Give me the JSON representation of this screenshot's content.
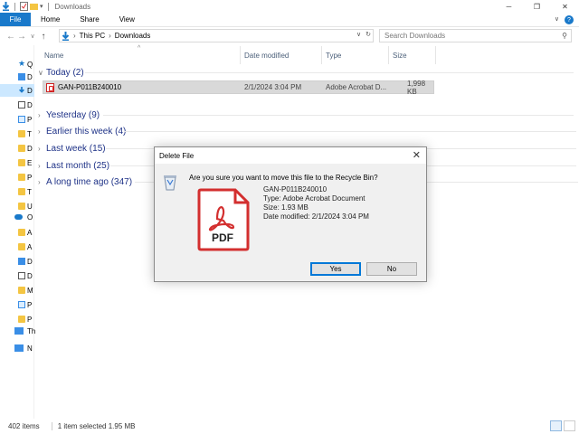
{
  "window": {
    "title": "Downloads",
    "controls": [
      "minimize-icon",
      "maximize-icon",
      "close-icon"
    ]
  },
  "ribbon": {
    "tabs": [
      "File",
      "Home",
      "Share",
      "View"
    ]
  },
  "address": {
    "path": [
      "This PC",
      "Downloads"
    ],
    "search_placeholder": "Search Downloads"
  },
  "nav_pane": {
    "items": [
      {
        "label": "Q",
        "icon": "star-icon"
      },
      {
        "label": "D",
        "icon": "desktop-icon"
      },
      {
        "label": "D",
        "icon": "download-icon"
      },
      {
        "label": "D",
        "icon": "document-icon"
      },
      {
        "label": "P",
        "icon": "pictures-icon"
      },
      {
        "label": "T",
        "icon": "folder-icon"
      },
      {
        "label": "D",
        "icon": "folder-icon"
      },
      {
        "label": "E",
        "icon": "folder-icon"
      },
      {
        "label": "P",
        "icon": "folder-icon"
      },
      {
        "label": "T",
        "icon": "folder-icon"
      },
      {
        "label": "U",
        "icon": "folder-icon"
      },
      {
        "label": "O",
        "icon": "cloud-icon"
      },
      {
        "label": "A",
        "icon": "folder-icon"
      },
      {
        "label": "A",
        "icon": "folder-icon"
      },
      {
        "label": "D",
        "icon": "desktop-icon"
      },
      {
        "label": "D",
        "icon": "document-icon"
      },
      {
        "label": "M",
        "icon": "folder-icon"
      },
      {
        "label": "P",
        "icon": "pictures-icon"
      },
      {
        "label": "P",
        "icon": "folder-icon"
      },
      {
        "label": "Th",
        "icon": "computer-icon"
      },
      {
        "label": "N",
        "icon": "network-icon"
      }
    ]
  },
  "columns": {
    "name": "Name",
    "date": "Date modified",
    "type": "Type",
    "size": "Size"
  },
  "groups": [
    {
      "label": "Today (2)",
      "expanded": true
    },
    {
      "label": "Yesterday (9)"
    },
    {
      "label": "Earlier this week (4)"
    },
    {
      "label": "Last week (15)"
    },
    {
      "label": "Last month (25)"
    },
    {
      "label": "A long time ago (347)"
    }
  ],
  "selected_file": {
    "name": "GAN-P011B240010",
    "date": "2/1/2024 3:04 PM",
    "type": "Adobe Acrobat D...",
    "size": "1,998 KB"
  },
  "status": {
    "count": "402 items",
    "selection": "1 item selected  1.95 MB"
  },
  "dialog": {
    "title": "Delete File",
    "question": "Are you sure you want to move this file to the Recycle Bin?",
    "file_name": "GAN-P011B240010",
    "file_type": "Type: Adobe Acrobat Document",
    "file_size": "Size: 1.93 MB",
    "file_date": "Date modified: 2/1/2024 3:04 PM",
    "thumbnail_label": "PDF",
    "yes_label": "Yes",
    "no_label": "No"
  },
  "colors": {
    "accent": "#1979ca",
    "group_text": "#1e3287",
    "pdf_red": "#d32f2f"
  }
}
